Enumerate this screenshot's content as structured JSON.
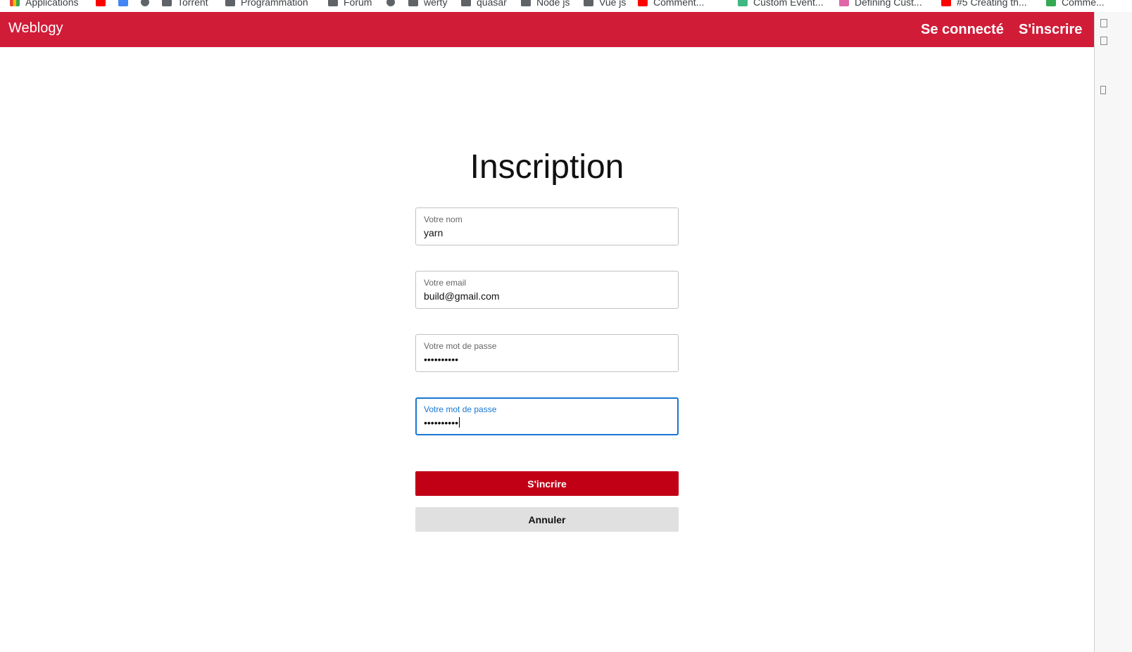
{
  "bookmarks": [
    {
      "label": "Applications",
      "icon": "apps-grid-icon"
    },
    {
      "label": "",
      "icon": "youtube-icon"
    },
    {
      "label": "",
      "icon": "translate-icon"
    },
    {
      "label": "",
      "icon": "settings-icon"
    },
    {
      "label": "Torrent",
      "icon": "folder-icon"
    },
    {
      "label": "Programmation",
      "icon": "folder-icon"
    },
    {
      "label": "Forum",
      "icon": "folder-icon"
    },
    {
      "label": "",
      "icon": "gear-icon"
    },
    {
      "label": "werty",
      "icon": "folder-icon"
    },
    {
      "label": "quasar",
      "icon": "folder-icon"
    },
    {
      "label": "Node js",
      "icon": "folder-icon"
    },
    {
      "label": "Vue js",
      "icon": "folder-icon"
    },
    {
      "label": "Comment...",
      "icon": "youtube-icon"
    },
    {
      "label": "Custom Event...",
      "icon": "vue-icon"
    },
    {
      "label": "Defining Cust...",
      "icon": "page-icon"
    },
    {
      "label": "#5 Creating th...",
      "icon": "youtube-icon"
    },
    {
      "label": "Comme...",
      "icon": "link-icon"
    }
  ],
  "navbar": {
    "brand": "Weblogy",
    "login": "Se connecté",
    "signup": "S'inscrire",
    "color": "#d11c38"
  },
  "form": {
    "title": "Inscription",
    "name": {
      "label": "Votre nom",
      "value": "yarn"
    },
    "email": {
      "label": "Votre email",
      "value": "build@gmail.com"
    },
    "password": {
      "label": "Votre mot de passe",
      "value": "••••••••••"
    },
    "password_confirm": {
      "label": "Votre mot de passe",
      "value": "••••••••••"
    },
    "submit": "S'incrire",
    "cancel": "Annuler",
    "focus_color": "#1976d2",
    "submit_color": "#c10016"
  }
}
